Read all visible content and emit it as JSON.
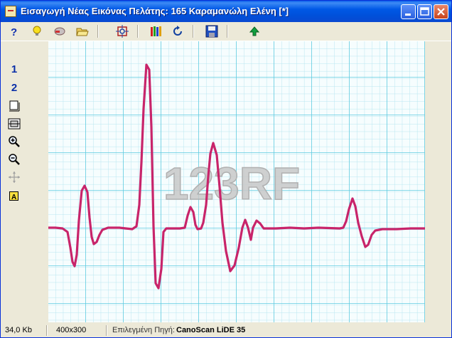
{
  "window": {
    "title": "Εισαγωγή Νέας Εικόνας Πελάτης: 165 Καραμανώλη Ελένη [*]"
  },
  "toolbar": {
    "icons": [
      "help-icon",
      "lightbulb-icon",
      "erase-icon",
      "open-folder-icon",
      "center-target-icon",
      "crayons-icon",
      "refresh-icon",
      "save-icon",
      "upload-arrow-icon"
    ]
  },
  "left_toolbar": {
    "item1": "1",
    "item2": "2",
    "icons": [
      "fit-page-icon",
      "fit-width-icon",
      "zoom-in-icon",
      "zoom-out-icon",
      "move-icon",
      "text-a-icon"
    ]
  },
  "image": {
    "watermark": "123RF"
  },
  "status": {
    "size_value": "34,0",
    "size_unit": "Kb",
    "dimensions": "400x300",
    "source_label": "Επιλεγμένη Πηγή:",
    "source_value": "CanoScan LiDE 35"
  },
  "colors": {
    "grid_minor": "#B7E6F0",
    "grid_major": "#5FCBE0",
    "trace": "#C8246A",
    "accent": "#0058E6"
  }
}
